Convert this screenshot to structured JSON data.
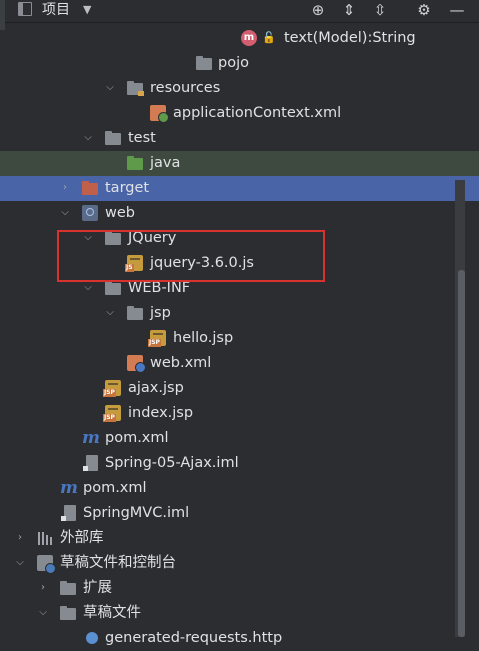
{
  "header": {
    "title": "项目"
  },
  "tree": [
    {
      "label": "text(Model):String",
      "kind": "method"
    },
    {
      "label": "pojo",
      "kind": "folder"
    },
    {
      "label": "resources",
      "kind": "folder-res",
      "expanded": true
    },
    {
      "label": "applicationContext.xml",
      "kind": "xml"
    },
    {
      "label": "test",
      "kind": "folder",
      "expanded": true
    },
    {
      "label": "java",
      "kind": "folder-green"
    },
    {
      "label": "target",
      "kind": "folder-red",
      "expanded": false,
      "selected": true
    },
    {
      "label": "web",
      "kind": "web-folder",
      "expanded": true
    },
    {
      "label": "JQuery",
      "kind": "folder",
      "expanded": true
    },
    {
      "label": "jquery-3.6.0.js",
      "kind": "js"
    },
    {
      "label": "WEB-INF",
      "kind": "folder",
      "expanded": true
    },
    {
      "label": "jsp",
      "kind": "folder",
      "expanded": true
    },
    {
      "label": "hello.jsp",
      "kind": "jsp"
    },
    {
      "label": "web.xml",
      "kind": "xml-web"
    },
    {
      "label": "ajax.jsp",
      "kind": "jsp"
    },
    {
      "label": "index.jsp",
      "kind": "jsp"
    },
    {
      "label": "pom.xml",
      "kind": "maven"
    },
    {
      "label": "Spring-05-Ajax.iml",
      "kind": "iml"
    },
    {
      "label": "pom.xml",
      "kind": "maven"
    },
    {
      "label": "SpringMVC.iml",
      "kind": "iml"
    },
    {
      "label": "外部库",
      "kind": "library",
      "expanded": false
    },
    {
      "label": "草稿文件和控制台",
      "kind": "scratch",
      "expanded": true
    },
    {
      "label": "扩展",
      "kind": "folder",
      "expanded": false
    },
    {
      "label": "草稿文件",
      "kind": "folder",
      "expanded": true
    },
    {
      "label": "generated-requests.http",
      "kind": "http"
    }
  ],
  "highlight": {
    "color": "#d8322f"
  }
}
